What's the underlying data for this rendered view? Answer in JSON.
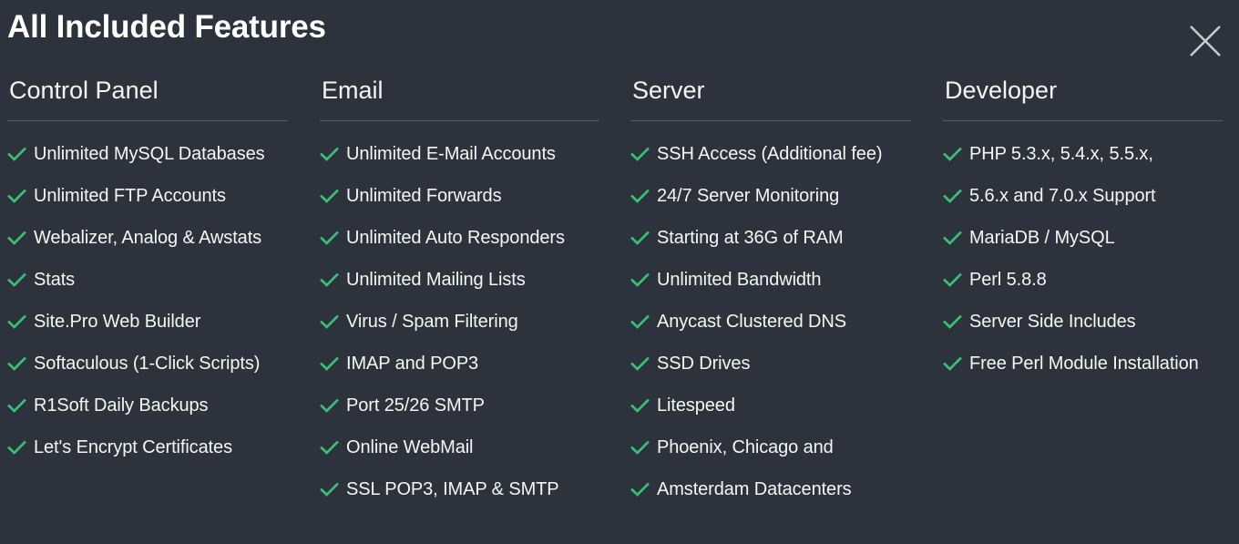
{
  "modal": {
    "title": "All Included Features",
    "close_label": "×",
    "close_icon": "close-icon",
    "check_icon": "check-icon"
  },
  "colors": {
    "background": "#2c333c",
    "title_text": "#ffffff",
    "header_text": "#f2f4f5",
    "body_text": "#f4f6f7",
    "check_green": "#3bbf75",
    "rule": "#555c64",
    "close_icon": "#c3cbd2"
  },
  "columns": [
    {
      "header": "Control Panel",
      "items": [
        "Unlimited MySQL Databases",
        "Unlimited FTP Accounts",
        "Webalizer, Analog & Awstats",
        "Stats",
        "Site.Pro Web Builder",
        "Softaculous (1-Click Scripts)",
        "R1Soft Daily Backups",
        "Let's Encrypt Certificates"
      ]
    },
    {
      "header": "Email",
      "items": [
        "Unlimited E-Mail Accounts",
        "Unlimited Forwards",
        "Unlimited Auto Responders",
        "Unlimited Mailing Lists",
        "Virus / Spam Filtering",
        "IMAP and POP3",
        "Port 25/26 SMTP",
        "Online WebMail",
        "SSL POP3, IMAP & SMTP"
      ]
    },
    {
      "header": "Server",
      "items": [
        "SSH Access (Additional fee)",
        "24/7 Server Monitoring",
        "Starting at 36G of RAM",
        "Unlimited Bandwidth",
        "Anycast Clustered DNS",
        "SSD Drives",
        "Litespeed",
        "Phoenix, Chicago and",
        "Amsterdam Datacenters"
      ]
    },
    {
      "header": "Developer",
      "items": [
        "PHP 5.3.x, 5.4.x, 5.5.x,",
        "5.6.x and 7.0.x Support",
        "MariaDB / MySQL",
        "Perl 5.8.8",
        "Server Side Includes",
        "Free Perl Module Installation"
      ]
    }
  ]
}
